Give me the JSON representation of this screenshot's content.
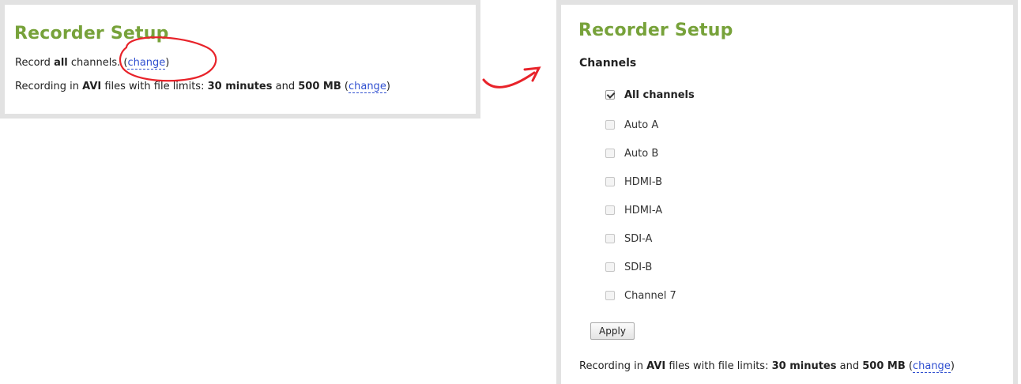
{
  "left_panel": {
    "title": "Recorder Setup",
    "record_prefix": "Record ",
    "record_bold": "all",
    "record_suffix": " channels.  (",
    "record_link": "change",
    "record_close": ")",
    "rec_prefix": "Recording in ",
    "rec_format": "AVI",
    "rec_mid": " files with file limits: ",
    "rec_time": "30 minutes",
    "rec_and": " and ",
    "rec_size": "500 MB",
    "rec_open": "  (",
    "rec_link": "change",
    "rec_close": ")"
  },
  "right_panel": {
    "title": "Recorder Setup",
    "channels_heading": "Channels",
    "options": [
      {
        "label": "All channels",
        "checked": true
      },
      {
        "label": "Auto A",
        "checked": false
      },
      {
        "label": "Auto B",
        "checked": false
      },
      {
        "label": "HDMI-B",
        "checked": false
      },
      {
        "label": "HDMI-A",
        "checked": false
      },
      {
        "label": "SDI-A",
        "checked": false
      },
      {
        "label": "SDI-B",
        "checked": false
      },
      {
        "label": "Channel 7",
        "checked": false
      }
    ],
    "apply_label": "Apply",
    "rec_prefix": "Recording in ",
    "rec_format": "AVI",
    "rec_mid": " files with file limits: ",
    "rec_time": "30 minutes",
    "rec_and": " and ",
    "rec_size": "500 MB",
    "rec_open": "  (",
    "rec_link": "change",
    "rec_close": ")"
  },
  "annotation": {
    "color": "#e8232a"
  }
}
